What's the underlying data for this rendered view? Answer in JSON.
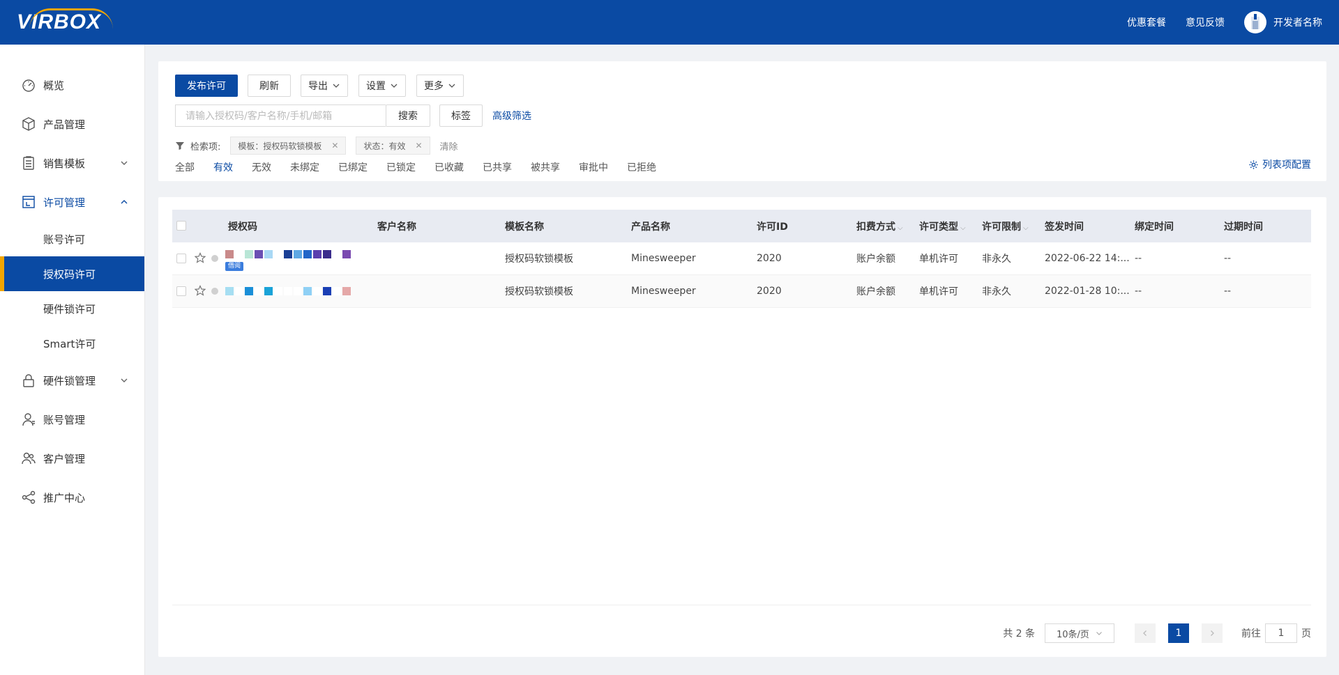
{
  "header": {
    "logo": "VIRBOX",
    "links": [
      "优惠套餐",
      "意见反馈"
    ],
    "user_name": "开发者名称"
  },
  "sidebar": {
    "items": [
      {
        "label": "概览",
        "icon": "dashboard-icon"
      },
      {
        "label": "产品管理",
        "icon": "box-icon"
      },
      {
        "label": "销售模板",
        "icon": "template-icon"
      },
      {
        "label": "许可管理",
        "icon": "license-icon"
      },
      {
        "label": "硬件锁管理",
        "icon": "lock-icon"
      },
      {
        "label": "账号管理",
        "icon": "account-icon"
      },
      {
        "label": "客户管理",
        "icon": "customers-icon"
      },
      {
        "label": "推广中心",
        "icon": "share-icon"
      }
    ],
    "sub_items": [
      "账号许可",
      "授权码许可",
      "硬件锁许可",
      "Smart许可"
    ]
  },
  "toolbar": {
    "issue": "发布许可",
    "refresh": "刷新",
    "export": "导出",
    "settings": "设置",
    "more": "更多",
    "search_placeholder": "请输入授权码/客户名称/手机/邮箱",
    "search": "搜索",
    "tags": "标签",
    "advanced": "高级筛选"
  },
  "filter": {
    "label": "检索项:",
    "tags": [
      "模板：授权码软锁模板",
      "状态：有效"
    ],
    "clear": "清除"
  },
  "status_tabs": [
    "全部",
    "有效",
    "无效",
    "未绑定",
    "已绑定",
    "已锁定",
    "已收藏",
    "已共享",
    "被共享",
    "审批中",
    "已拒绝"
  ],
  "column_config": "列表项配置",
  "table": {
    "columns": [
      "授权码",
      "客户名称",
      "模板名称",
      "产品名称",
      "许可ID",
      "扣费方式",
      "许可类型",
      "许可限制",
      "签发时间",
      "绑定时间",
      "过期时间"
    ],
    "rows": [
      {
        "customer": "",
        "template": "授权码软锁模板",
        "product": "Minesweeper",
        "license_id": "2020",
        "billing": "账户余额",
        "type": "单机许可",
        "limit": "非永久",
        "issued": "2022-06-22 14:...",
        "bound": "--",
        "expires": "--",
        "badge": "借阅"
      },
      {
        "customer": "",
        "template": "授权码软锁模板",
        "product": "Minesweeper",
        "license_id": "2020",
        "billing": "账户余额",
        "type": "单机许可",
        "limit": "非永久",
        "issued": "2022-01-28 10:...",
        "bound": "--",
        "expires": "--",
        "badge": ""
      }
    ]
  },
  "pagination": {
    "total": "共 2 条",
    "page_size": "10条/页",
    "current": "1",
    "goto_prefix": "前往",
    "goto_value": "1",
    "goto_suffix": "页"
  },
  "colors": {
    "primary": "#0a4aa3",
    "accent": "#f0a500"
  }
}
